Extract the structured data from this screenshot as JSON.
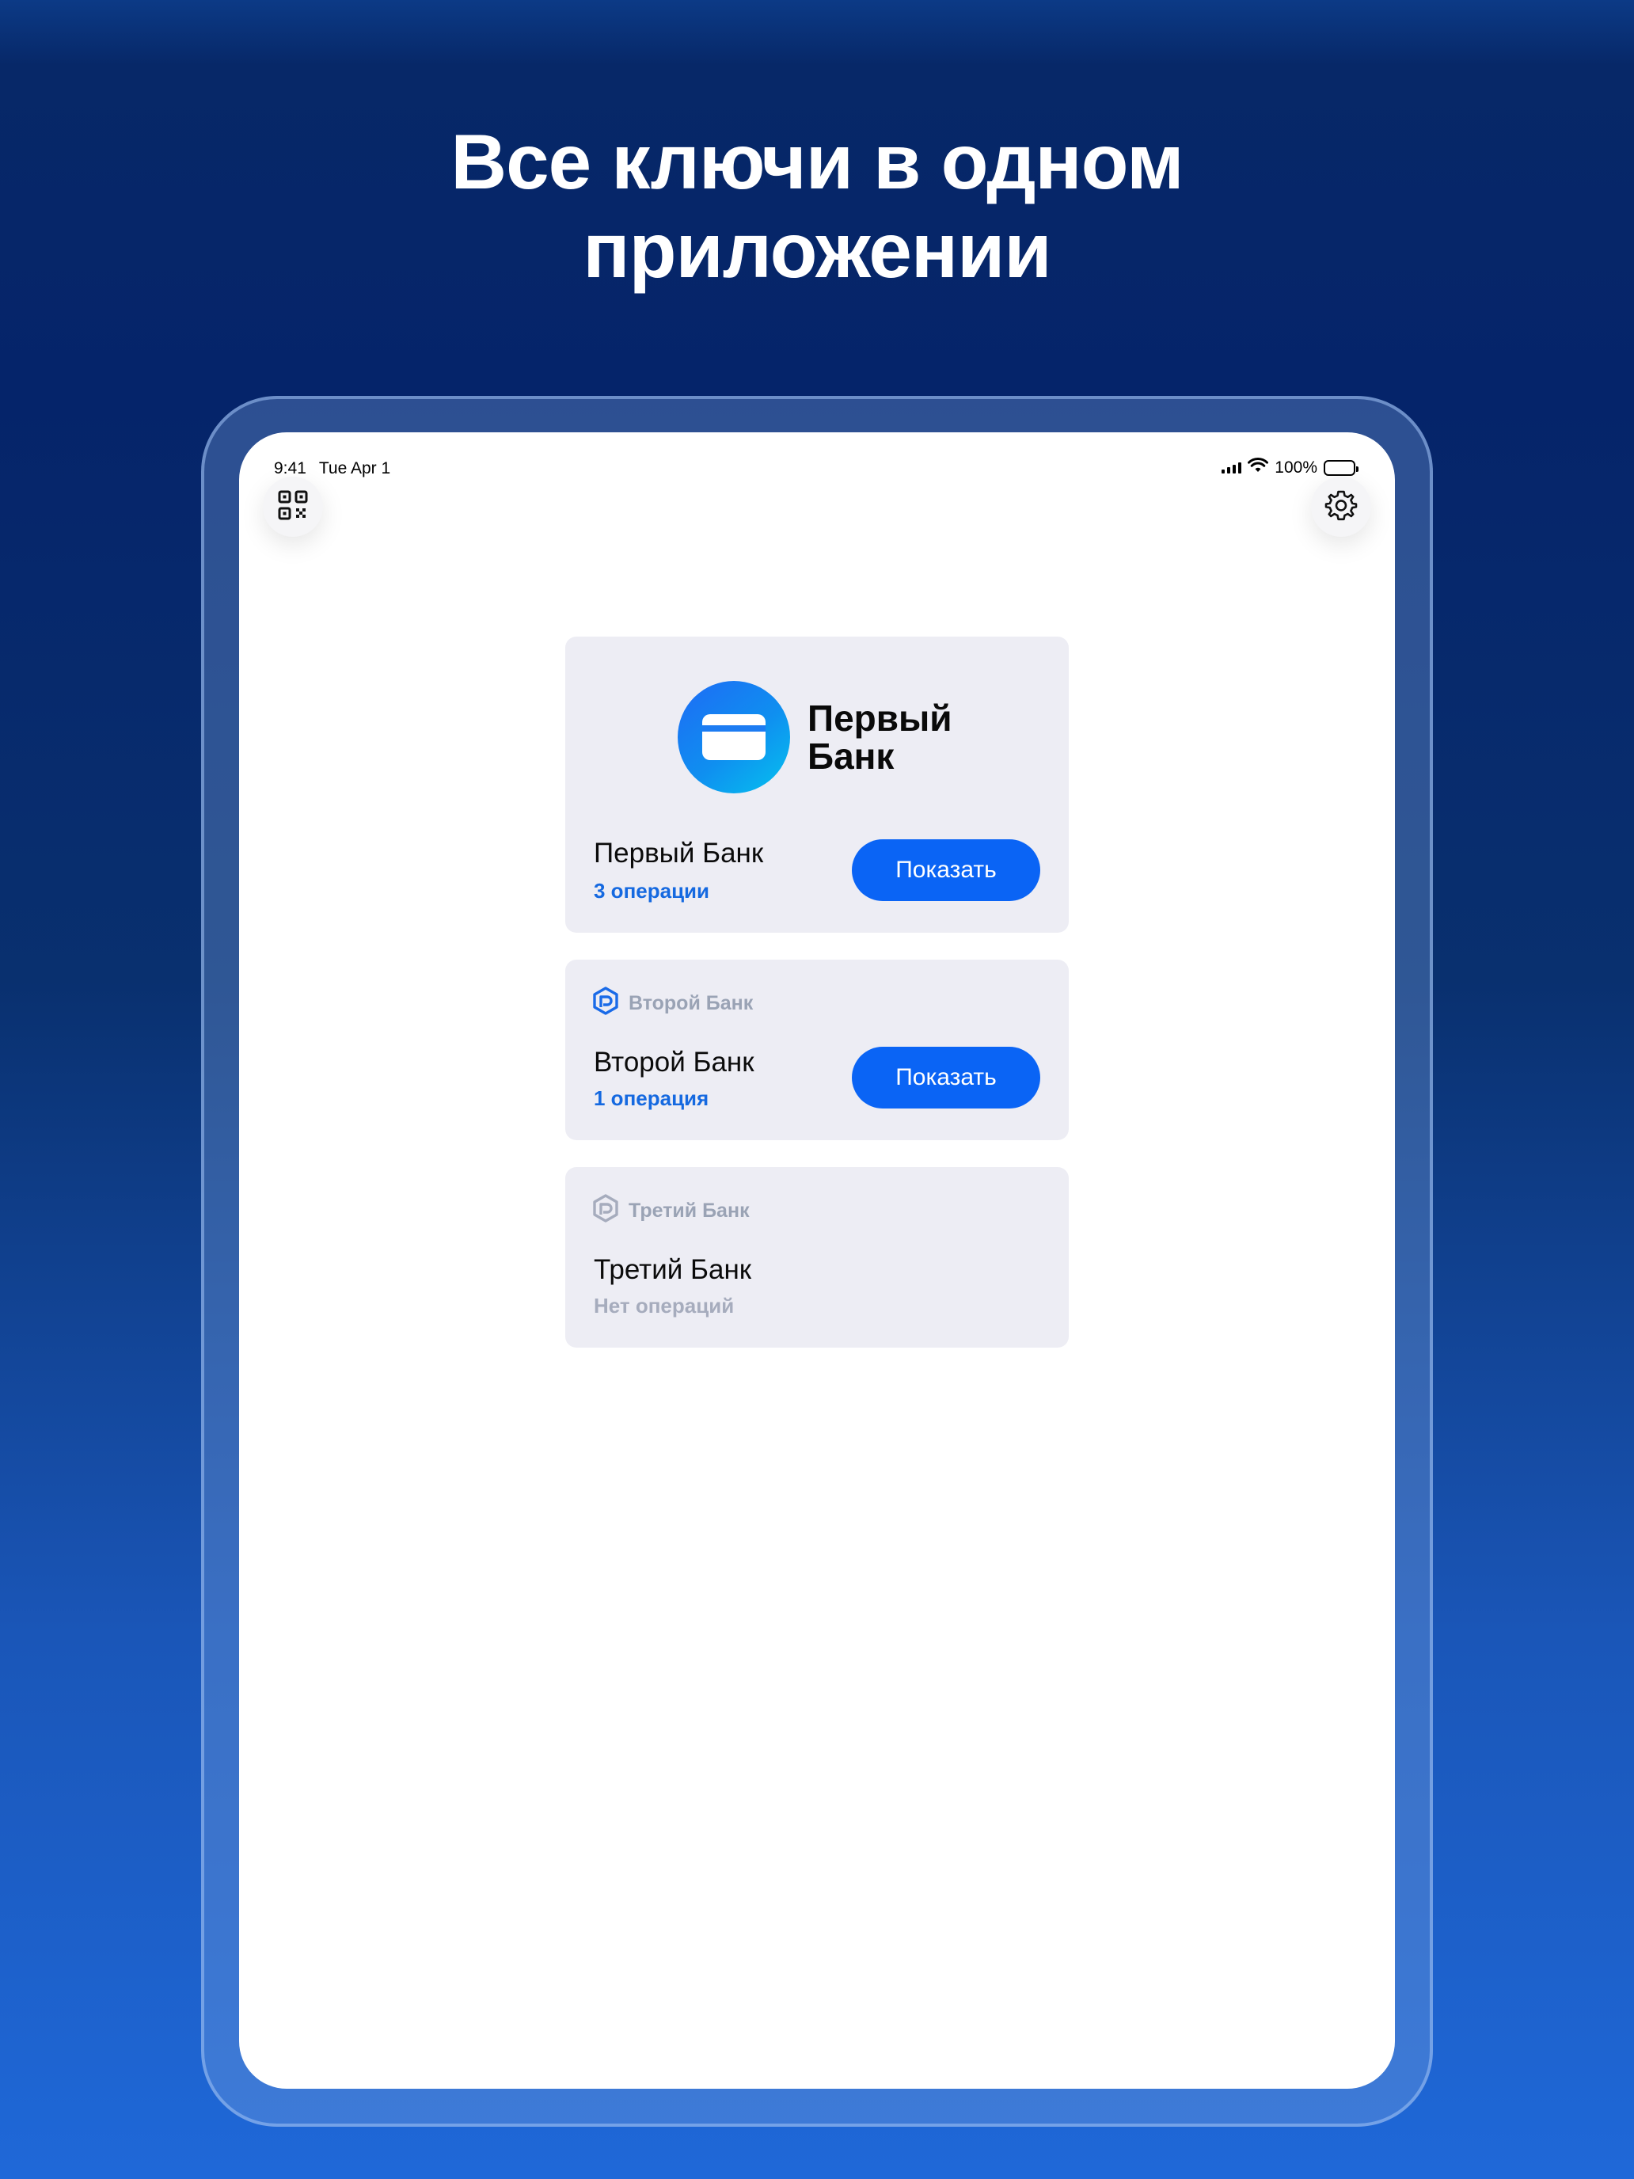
{
  "headline": {
    "line1": "Все ключи в одном",
    "line2": "приложении"
  },
  "status_bar": {
    "time": "9:41",
    "date": "Tue Apr 1",
    "battery": "100%"
  },
  "toolbar": {
    "qr_icon": "qr-code-icon",
    "settings_icon": "gear-icon"
  },
  "banks": [
    {
      "logo_line1": "Первый",
      "logo_line2": "Банк",
      "name": "Первый Банк",
      "operations": "3 операции",
      "button": "Показать"
    },
    {
      "brand_label": "Второй Банк",
      "name": "Второй Банк",
      "operations": "1 операция",
      "button": "Показать"
    },
    {
      "brand_label": "Третий Банк",
      "name": "Третий Банк",
      "operations": "Нет операций"
    }
  ],
  "colors": {
    "accent": "#0a64f5",
    "operations_link": "#1569e0",
    "card_background": "#ededf4"
  }
}
